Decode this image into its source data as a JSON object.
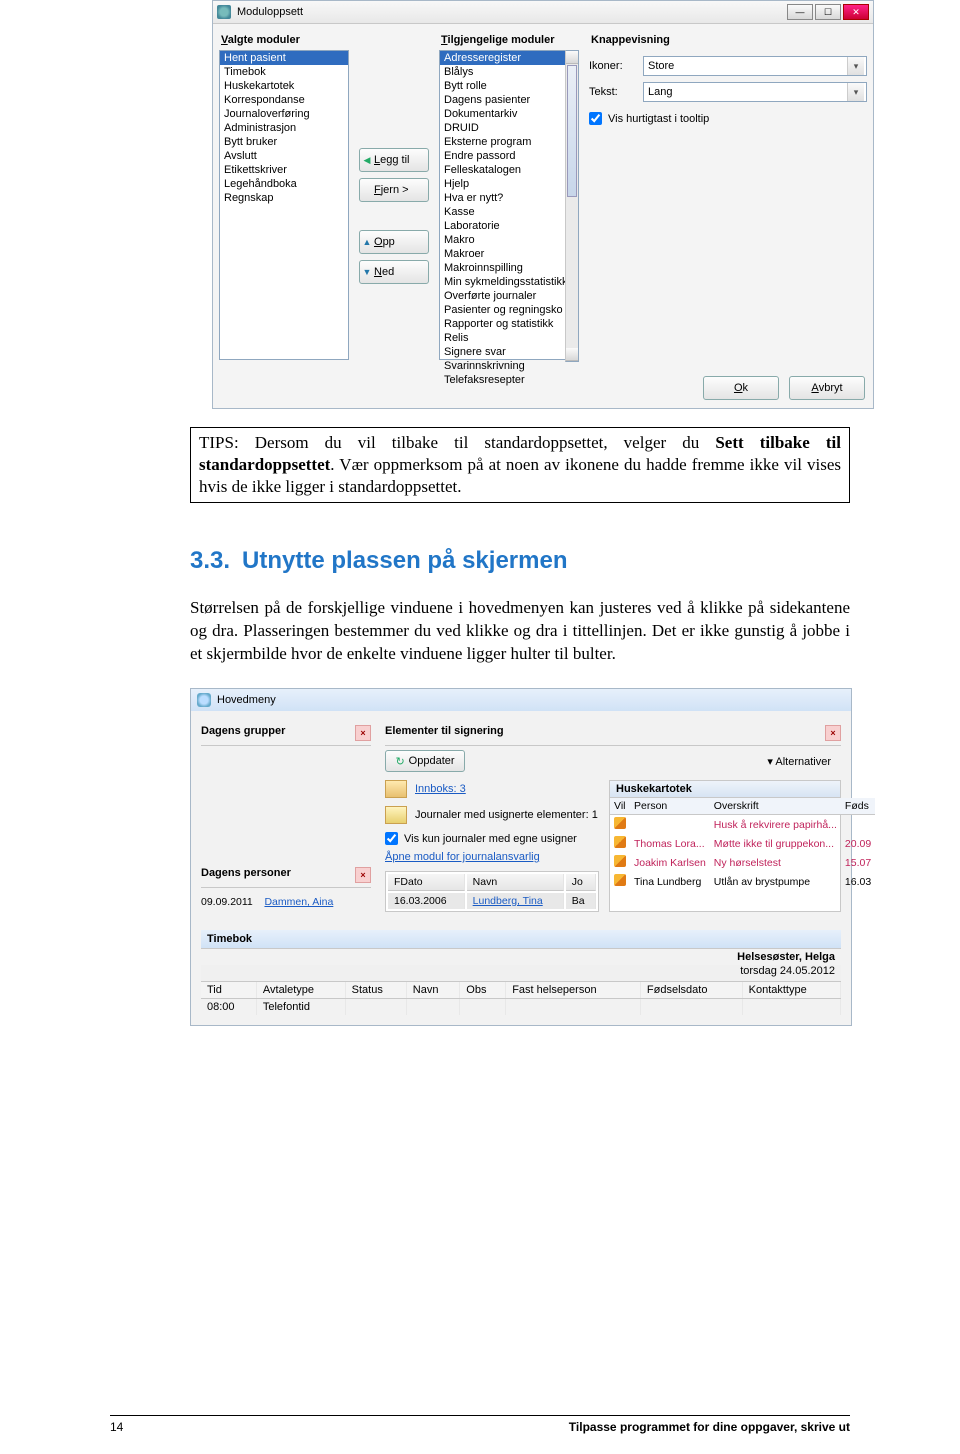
{
  "dialog": {
    "title": "Moduloppsett",
    "col_selected": "Valgte moduler",
    "col_available": "Tilgjengelige moduler",
    "col_preview": "Knappevisning",
    "selected": [
      "Hent pasient",
      "Timebok",
      "Huskekartotek",
      "Korrespondanse",
      "Journaloverføring",
      "Administrasjon",
      "Bytt bruker",
      "Avslutt",
      "Etikettskriver",
      "Legehåndboka",
      "Regnskap"
    ],
    "available": [
      "Adresseregister",
      "Blålys",
      "Bytt rolle",
      "Dagens pasienter",
      "Dokumentarkiv",
      "DRUID",
      "Eksterne program",
      "Endre passord",
      "Felleskatalogen",
      "Hjelp",
      "Hva er nytt?",
      "Kasse",
      "Laboratorie",
      "Makro",
      "Makroer",
      "Makroinnspilling",
      "Min sykmeldingsstatistikk",
      "Overførte journaler",
      "Pasienter og regningsko",
      "Rapporter og statistikk",
      "Relis",
      "Signere svar",
      "Svarinnskrivning",
      "Telefaksresepter"
    ],
    "btn_add": "Legg til",
    "btn_remove": "Fjern >",
    "btn_up": "Opp",
    "btn_down": "Ned",
    "lbl_ikoner": "Ikoner:",
    "val_ikoner": "Store",
    "lbl_tekst": "Tekst:",
    "val_tekst": "Lang",
    "chk_tooltip": "Vis hurtigtast i tooltip",
    "btn_ok": "Ok",
    "btn_cancel": "Avbryt"
  },
  "tips": {
    "text_a": "TIPS: Dersom du vil tilbake til standardoppsettet, velger du ",
    "text_b": "Sett tilbake til standardoppsettet",
    "text_c": ". Vær oppmerksom på at noen av ikonene du hadde fremme ikke vil vises hvis de ikke ligger i standardoppsettet."
  },
  "section": {
    "num": "3.3.",
    "title": "Utnytte plassen på skjermen",
    "body": "Størrelsen på de forskjellige vinduene i hovedmenyen kan justeres ved å klikke på sidekantene og dra. Plasseringen bestemmer du ved klikke og dra i tittellinjen. Det er ikke gunstig å jobbe i et skjermbilde hvor de enkelte vinduene ligger hulter til bulter."
  },
  "hoved": {
    "menu": "Hovedmeny",
    "dagens_grupper": "Dagens grupper",
    "dagens_personer": "Dagens personer",
    "dp_date": "09.09.2011",
    "dp_name": "Dammen, Aina",
    "elementer": "Elementer til signering",
    "oppdater": "Oppdater",
    "alternativer": "Alternativer",
    "innboks": "Innboks: 3",
    "jusign": "Journaler med usignerte elementer: 1",
    "viskun": "Vis kun journaler med egne usigner",
    "apne": "Åpne modul for journalansvarlig",
    "fdato_h": "FDato",
    "navn_h": "Navn",
    "jo_h": "Jo",
    "fdato_v": "16.03.2006",
    "navn_v": "Lundberg, Tina",
    "jo_v": "Ba",
    "husk": {
      "title": "Huskekartotek",
      "h_vil": "Vil",
      "h_person": "Person",
      "h_over": "Overskrift",
      "h_fod": "Føds",
      "r1_over": "Husk å rekvirere papirhå...",
      "r2_person": "Thomas Lora...",
      "r2_over": "Møtte ikke til gruppekon...",
      "r2_f": "20.09",
      "r3_person": "Joakim Karlsen",
      "r3_over": "Ny hørselstest",
      "r3_f": "15.07",
      "r4_person": "Tina Lundberg",
      "r4_over": "Utlån av brystpumpe",
      "r4_f": "16.03"
    }
  },
  "timebok": {
    "title": "Timebok",
    "user": "Helsesøster, Helga",
    "date": "torsdag 24.05.2012",
    "h_tid": "Tid",
    "h_avt": "Avtaletype",
    "h_stat": "Status",
    "h_navn": "Navn",
    "h_obs": "Obs",
    "h_fast": "Fast helseperson",
    "h_fd": "Fødselsdato",
    "h_kon": "Kontakttype",
    "r_tid": "08:00",
    "r_avt": "Telefontid"
  },
  "footer": {
    "page": "14",
    "caption": "Tilpasse programmet for dine oppgaver, skrive ut"
  }
}
